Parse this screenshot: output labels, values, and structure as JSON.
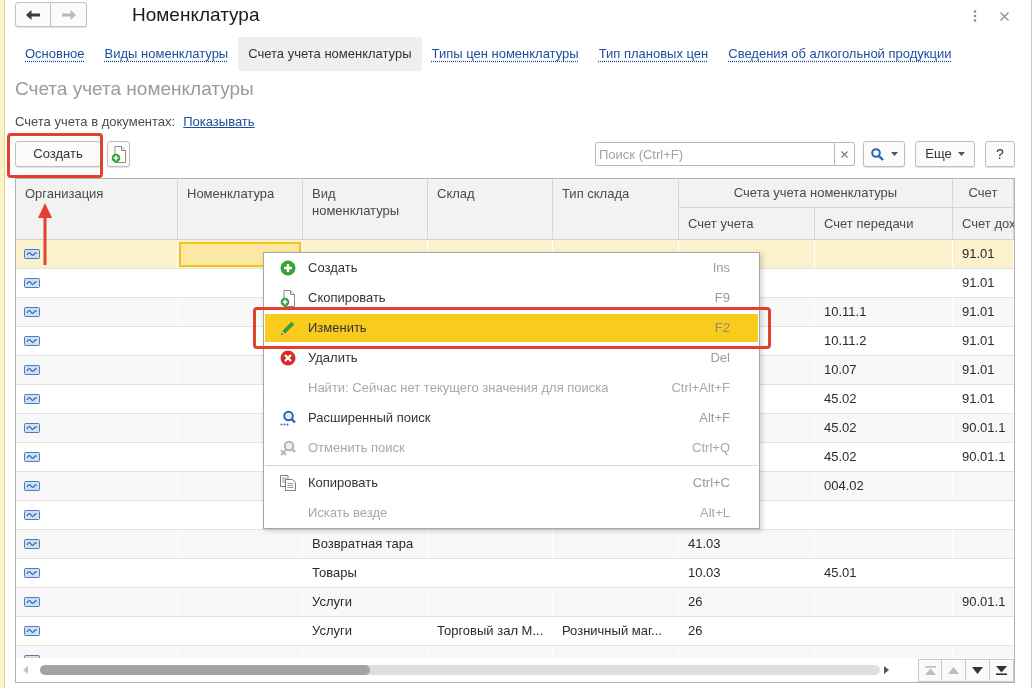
{
  "window": {
    "title": "Номенклатура"
  },
  "navigation": [
    {
      "kind": "back",
      "disabled": false
    },
    {
      "kind": "forward",
      "disabled": true
    }
  ],
  "tabs": [
    {
      "label": "Основное",
      "selected": false
    },
    {
      "label": "Виды номенклатуры",
      "selected": false
    },
    {
      "label": "Счета учета номенклатуры",
      "selected": true
    },
    {
      "label": "Типы цен номенклатуры",
      "selected": false
    },
    {
      "label": "Тип плановых цен",
      "selected": false
    },
    {
      "label": "Сведения об алкогольной продукции",
      "selected": false
    }
  ],
  "heading": "Счета учета номенклатуры",
  "documents_setting": {
    "label": "Счета учета в документах:",
    "link": "Показывать"
  },
  "toolbar": {
    "create_button": {
      "label": "Создать",
      "annotated": true
    },
    "search": {
      "placeholder": "Поиск (Ctrl+F)"
    },
    "more_button": "Еще",
    "help_button": "?"
  },
  "table": {
    "columns": [
      {
        "label": "Организация"
      },
      {
        "label": "Номенклатура"
      },
      {
        "label": "Вид номенклатуры"
      },
      {
        "label": "Склад"
      },
      {
        "label": "Тип склада"
      },
      {
        "label": "Счета учета номенклатуры",
        "children": [
          {
            "label": "Счет учета"
          },
          {
            "label": "Счет передачи"
          }
        ]
      },
      {
        "label": "Счет",
        "children": [
          {
            "label": "Счет дох"
          }
        ]
      }
    ],
    "rows": [
      {
        "selected": true,
        "nomenclature": {
          "focused": true
        },
        "income_account": "91.01"
      },
      {
        "selected": false,
        "income_account": "91.01"
      },
      {
        "selected": false,
        "transfer_account": "10.11.1",
        "income_account": "91.01"
      },
      {
        "selected": false,
        "transfer_account": "10.11.2",
        "income_account": "91.01"
      },
      {
        "selected": false,
        "transfer_account": "10.07",
        "income_account": "91.01"
      },
      {
        "selected": false,
        "transfer_account": "45.02",
        "income_account": "91.01"
      },
      {
        "selected": false,
        "transfer_account": "45.02",
        "income_account": "90.01.1"
      },
      {
        "selected": false,
        "transfer_account": "45.02",
        "income_account": "90.01.1"
      },
      {
        "selected": false,
        "transfer_account": "004.02"
      },
      {
        "selected": false
      },
      {
        "selected": false,
        "item_kind": "Возвратная тара",
        "account": "41.03"
      },
      {
        "selected": false,
        "item_kind": "Товары",
        "account": "10.03",
        "transfer_account": "45.01"
      },
      {
        "selected": false,
        "item_kind": "Услуги",
        "account": "26",
        "income_account": "90.01.1"
      },
      {
        "selected": false,
        "item_kind": "Услуги",
        "warehouse": "Торговый зал М...",
        "warehouse_type": "Розничный маг...",
        "account": "26"
      },
      {
        "selected": false
      }
    ]
  },
  "table_navigation": [
    {
      "kind": "first",
      "disabled": true
    },
    {
      "kind": "up",
      "disabled": true
    },
    {
      "kind": "down",
      "disabled": false
    },
    {
      "kind": "last",
      "disabled": false
    }
  ],
  "context_menu": {
    "items": [
      {
        "kind": "create",
        "label": "Создать",
        "shortcut": "Ins",
        "disabled": false,
        "selected": false
      },
      {
        "kind": "copy",
        "label": "Скопировать",
        "shortcut": "F9",
        "disabled": false,
        "selected": false
      },
      {
        "kind": "edit",
        "label": "Изменить",
        "shortcut": "F2",
        "disabled": false,
        "selected": true,
        "annotated": true
      },
      {
        "kind": "delete",
        "label": "Удалить",
        "shortcut": "Del",
        "disabled": false,
        "selected": false
      },
      {
        "kind": "find",
        "label": "Найти: Сейчас нет текущего значения для поиска",
        "shortcut": "Ctrl+Alt+F",
        "disabled": true,
        "selected": false
      },
      {
        "kind": "advanced_search",
        "label": "Расширенный поиск",
        "shortcut": "Alt+F",
        "disabled": false,
        "selected": false
      },
      {
        "kind": "cancel_search",
        "label": "Отменить поиск",
        "shortcut": "Ctrl+Q",
        "disabled": true,
        "selected": false
      },
      {
        "kind": "separator"
      },
      {
        "kind": "copy_to_clipboard",
        "label": "Копировать",
        "shortcut": "Ctrl+C",
        "disabled": false,
        "selected": false
      },
      {
        "kind": "search_everywhere",
        "label": "Искать везде",
        "shortcut": "Alt+L",
        "disabled": true,
        "selected": false
      }
    ]
  }
}
